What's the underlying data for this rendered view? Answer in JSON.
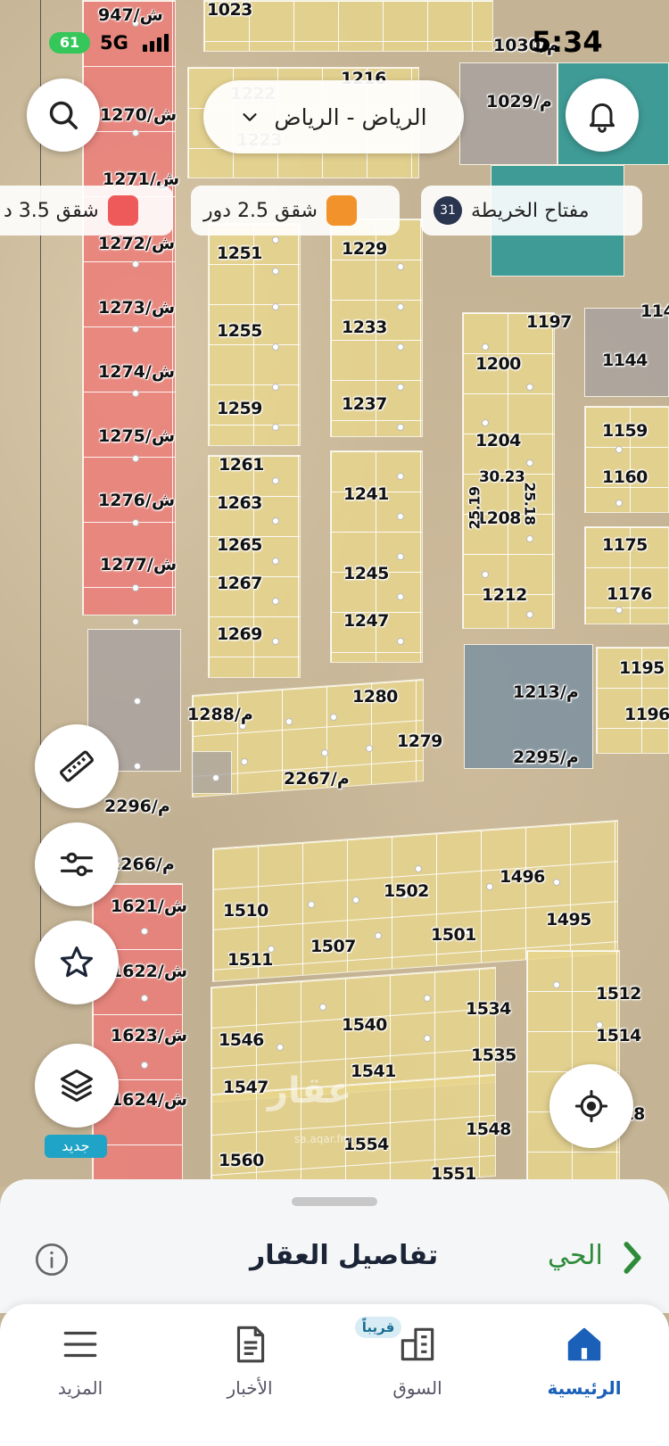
{
  "status_bar": {
    "time": "5:34",
    "battery": "61",
    "network": "5G"
  },
  "header": {
    "city_selector": "الرياض - الرياض"
  },
  "legend_chips": [
    {
      "label": "مفتاح الخريطة",
      "count": "31"
    },
    {
      "label": "شقق 2.5 دور",
      "color": "#f2922a"
    },
    {
      "label": "شقق 3.5 د",
      "color": "#ee5a5a"
    }
  ],
  "map": {
    "labels": {
      "l947": "947/ش",
      "l1023": "1023",
      "l1030": "1030/م",
      "l1029": "1029/م",
      "l1216": "1216",
      "l1222": "1222",
      "l1223": "1223",
      "l1270": "1270/ش",
      "l1271": "1271/ش",
      "l1272": "1272/ش",
      "l1273": "1273/ش",
      "l1274": "1274/ش",
      "l1275": "1275/ش",
      "l1276": "1276/ش",
      "l1277": "1277/ش",
      "l1251": "1251",
      "l1255": "1255",
      "l1259": "1259",
      "l1261": "1261",
      "l1263": "1263",
      "l1265": "1265",
      "l1267": "1267",
      "l1269": "1269",
      "l1229": "1229",
      "l1233": "1233",
      "l1237": "1237",
      "l1241": "1241",
      "l1245": "1245",
      "l1247": "1247",
      "l1197": "1197",
      "l1200": "1200",
      "l1204": "1204",
      "l1208": "1208",
      "l1212": "1212",
      "l3023": "30.23",
      "l2519a": "25.19",
      "l2518b": "25.18",
      "l1144": "1144",
      "l114x": "114",
      "l1159": "1159",
      "l1160": "1160",
      "l1175": "1175",
      "l1176": "1176",
      "l1195": "1195",
      "l1196": "1196",
      "l1213": "1213/م",
      "l2295": "2295/م",
      "l1280": "1280",
      "l1279": "1279",
      "l1288": "1288/م",
      "l2267": "2267/م",
      "l2296": "2296/م",
      "l2266": "2266/م",
      "l1621": "1621/ش",
      "l1622": "1622/ش",
      "l1623": "1623/ش",
      "l1624": "1624/ش",
      "l1510": "1510",
      "l1511": "1511",
      "l1502": "1502",
      "l1507": "1507",
      "l1496": "1496",
      "l1501": "1501",
      "l1495": "1495",
      "l1512": "1512",
      "l1514": "1514",
      "l1534": "1534",
      "l1540": "1540",
      "l1546": "1546",
      "l1535": "1535",
      "l1541": "1541",
      "l1547": "1547",
      "l1548": "1548",
      "l1554": "1554",
      "l1560": "1560",
      "l1518": "1518",
      "l1551": "1551"
    },
    "watermark": "عقار",
    "watermark_sub": "sa.aqar.fm"
  },
  "tools": {
    "new_badge": "جديد"
  },
  "sheet": {
    "title": "تفاصيل العقار",
    "link": "الحي"
  },
  "tabbar": {
    "tabs": [
      {
        "label": "الرئيسية"
      },
      {
        "label": "السوق"
      },
      {
        "label": "الأخبار"
      },
      {
        "label": "المزيد"
      }
    ],
    "soon_badge": "قريباً"
  },
  "colors": {
    "accent_blue": "#1a5fb8",
    "link_green": "#2e8b3a",
    "plot_yellow": "#e8d68c",
    "plot_red": "#eb7d78"
  }
}
